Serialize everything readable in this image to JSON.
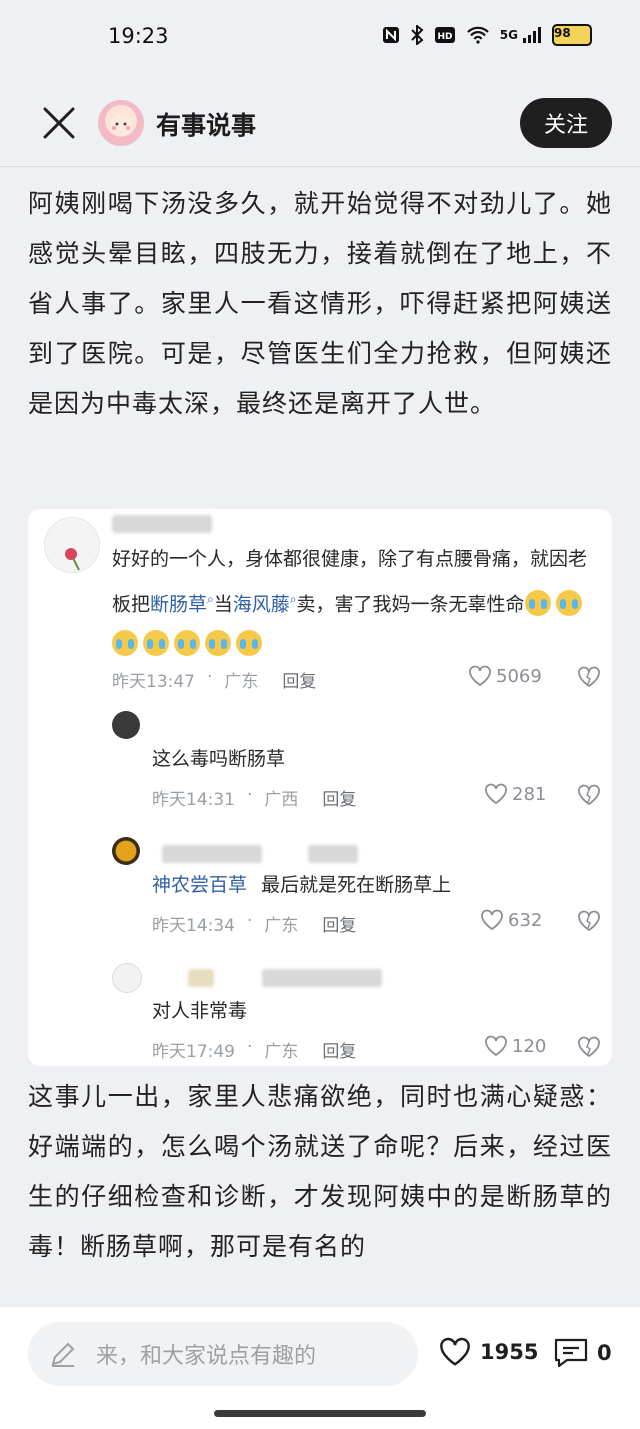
{
  "status_bar": {
    "time": "19:23",
    "network": "5G",
    "battery": "98",
    "icons": [
      "nfc-icon",
      "bluetooth-icon",
      "hd-icon",
      "wifi-icon",
      "signal-icon"
    ]
  },
  "header": {
    "channel_name": "有事说事",
    "follow_label": "关注"
  },
  "article": {
    "paragraph_1": "阿姨刚喝下汤没多久，就开始觉得不对劲儿了。她感觉头晕目眩，四肢无力，接着就倒在了地上，不省人事了。家里人一看这情形，吓得赶紧把阿姨送到了医院。可是，尽管医生们全力抢救，但阿姨还是因为中毒太深，最终还是离开了人世。",
    "paragraph_2": "这事儿一出，家里人悲痛欲绝，同时也满心疑惑：好端端的，怎么喝个汤就送了命呢？后来，经过医生的仔细检查和诊断，才发现阿姨中的是断肠草的毒！断肠草啊，那可是有名的"
  },
  "comments": [
    {
      "text_before": "好好的一个人，身体都很健康，除了有点腰骨痛，就因老板把",
      "link_1": "断肠草",
      "text_mid": "当",
      "link_2": "海风藤",
      "text_after": "卖，害了我妈一条无辜性命",
      "time": "昨天13:47",
      "location": "广东",
      "reply": "回复",
      "likes": "5069"
    },
    {
      "text": "这么毒吗断肠草",
      "time": "昨天14:31",
      "location": "广西",
      "reply": "回复",
      "likes": "281"
    },
    {
      "mention": "神农尝百草",
      "text": "最后就是死在断肠草上",
      "time": "昨天14:34",
      "location": "广东",
      "reply": "回复",
      "likes": "632"
    },
    {
      "text": "对人非常毒",
      "time": "昨天17:49",
      "location": "广东",
      "reply": "回复",
      "likes": "120"
    }
  ],
  "bottom_bar": {
    "comment_placeholder": "来，和大家说点有趣的",
    "like_count": "1955",
    "comment_count": "0"
  }
}
